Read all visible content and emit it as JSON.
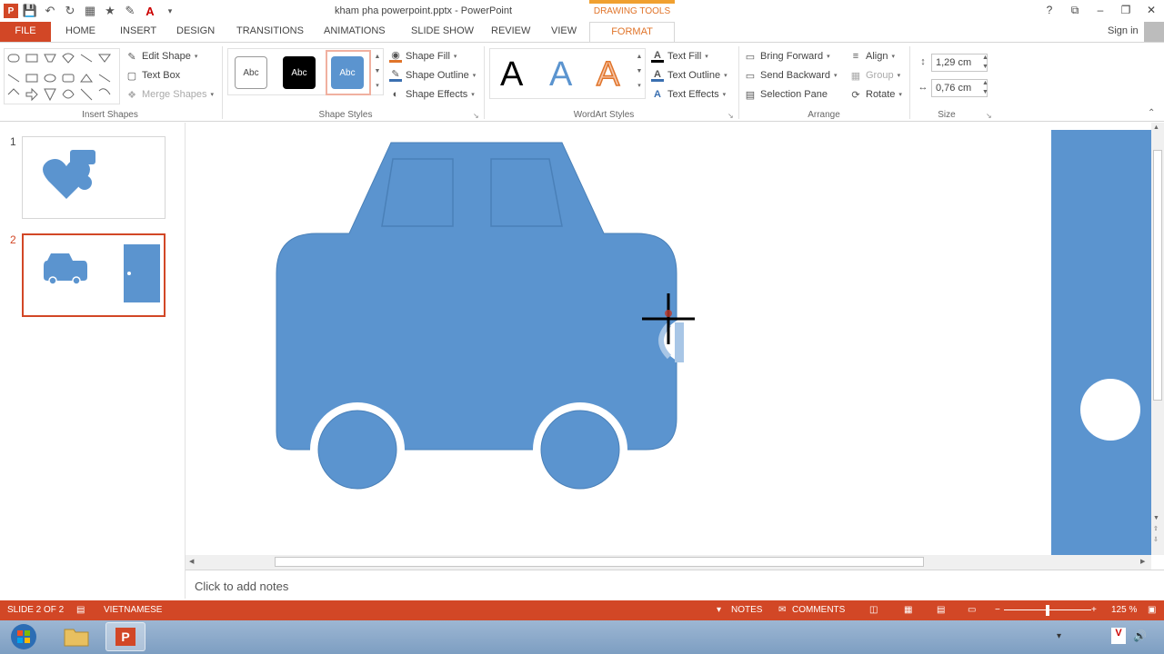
{
  "titlebar": {
    "doc_title": "kham pha powerpoint.pptx - PowerPoint",
    "context_group": "DRAWING TOOLS",
    "controls": [
      "?",
      "⧉",
      "–",
      "❐",
      "✕"
    ]
  },
  "tabs": [
    "FILE",
    "HOME",
    "INSERT",
    "DESIGN",
    "TRANSITIONS",
    "ANIMATIONS",
    "SLIDE SHOW",
    "REVIEW",
    "VIEW",
    "FORMAT"
  ],
  "account": {
    "signin": "Sign in"
  },
  "ribbon": {
    "insert_shapes": {
      "label": "Insert Shapes",
      "edit_shape": "Edit Shape",
      "text_box": "Text Box",
      "merge_shapes": "Merge Shapes"
    },
    "shape_styles": {
      "label": "Shape Styles",
      "presets": [
        "Abc",
        "Abc",
        "Abc"
      ],
      "shape_fill": "Shape Fill",
      "shape_outline": "Shape Outline",
      "shape_effects": "Shape Effects"
    },
    "wordart_styles": {
      "label": "WordArt Styles",
      "presets": [
        "A",
        "A",
        "A"
      ],
      "text_fill": "Text Fill",
      "text_outline": "Text Outline",
      "text_effects": "Text Effects"
    },
    "arrange": {
      "label": "Arrange",
      "bring_forward": "Bring Forward",
      "send_backward": "Send Backward",
      "selection_pane": "Selection Pane",
      "align": "Align",
      "group": "Group",
      "rotate": "Rotate"
    },
    "size": {
      "label": "Size",
      "height": "1,29 cm",
      "width": "0,76 cm"
    }
  },
  "slides": [
    {
      "number": "1"
    },
    {
      "number": "2"
    }
  ],
  "notes": {
    "placeholder": "Click to add notes"
  },
  "status": {
    "slide_info": "SLIDE 2 OF 2",
    "language": "VIETNAMESE",
    "notes": "NOTES",
    "comments": "COMMENTS",
    "zoom": "125 %"
  },
  "colors": {
    "accent": "#d24726",
    "shape_blue": "#5b94cf",
    "format_orange": "#e0742a"
  }
}
